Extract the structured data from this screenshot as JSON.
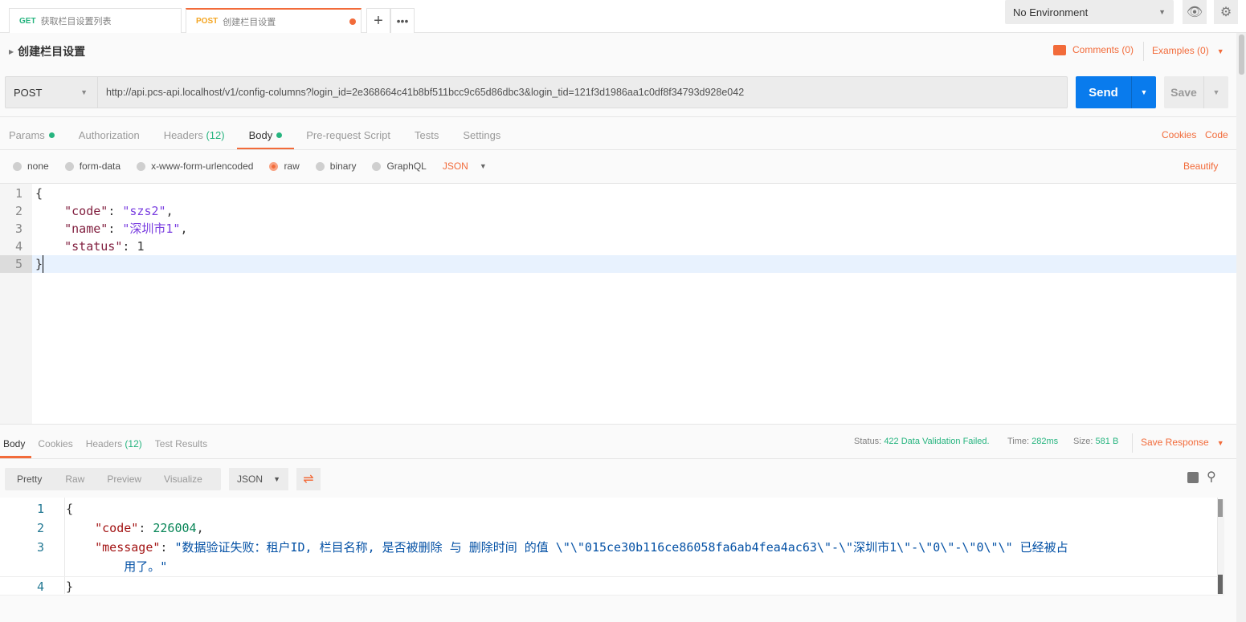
{
  "tabs": [
    {
      "method": "GET",
      "title": "获取栏目设置列表"
    },
    {
      "method": "POST",
      "title": "创建栏目设置"
    }
  ],
  "environment": "No Environment",
  "request_name": "创建栏目设置",
  "comments": "Comments (0)",
  "examples": "Examples (0)",
  "method": "POST",
  "url": "http://api.pcs-api.localhost/v1/config-columns?login_id=2e368664c41b8bf511bcc9c65d86dbc3&login_tid=121f3d1986aa1c0df8f34793d928e042",
  "send": "Send",
  "save": "Save",
  "request_tabs": {
    "params": "Params",
    "authorization": "Authorization",
    "headers": "Headers",
    "headers_count": "(12)",
    "body": "Body",
    "prerequest": "Pre-request Script",
    "tests": "Tests",
    "settings": "Settings"
  },
  "cookies": "Cookies",
  "code": "Code",
  "body_modes": [
    "none",
    "form-data",
    "x-www-form-urlencoded",
    "raw",
    "binary",
    "GraphQL"
  ],
  "body_format": "JSON",
  "beautify": "Beautify",
  "request_body": {
    "l1": "{",
    "k_code": "\"code\"",
    "v_code": "\"szs2\"",
    "k_name": "\"name\"",
    "v_name": "\"深圳市1\"",
    "k_status": "\"status\"",
    "v_status": "1",
    "l5": "}"
  },
  "response_tabs": {
    "body": "Body",
    "cookies": "Cookies",
    "headers": "Headers",
    "headers_count": "(12)",
    "tests": "Test Results"
  },
  "status_label": "Status:",
  "status": "422 Data Validation Failed.",
  "time_label": "Time:",
  "time": "282ms",
  "size_label": "Size:",
  "size": "581 B",
  "save_response": "Save Response",
  "view_modes": [
    "Pretty",
    "Raw",
    "Preview",
    "Visualize"
  ],
  "response_format": "JSON",
  "response_body": {
    "l1": "{",
    "k_code": "\"code\"",
    "v_code": "226004",
    "k_message": "\"message\"",
    "v_message_1": "\"数据验证失败：租户ID, 栏目名称, 是否被删除 与 删除时间 的值 \\\"\\\"015ce30b116ce86058fa6ab4fea4ac63\\\"-\\\"深圳市1\\\"-\\\"0\\\"-\\\"0\\\"\\\" 已经被占",
    "v_message_2": "用了。\"",
    "l4": "}"
  }
}
